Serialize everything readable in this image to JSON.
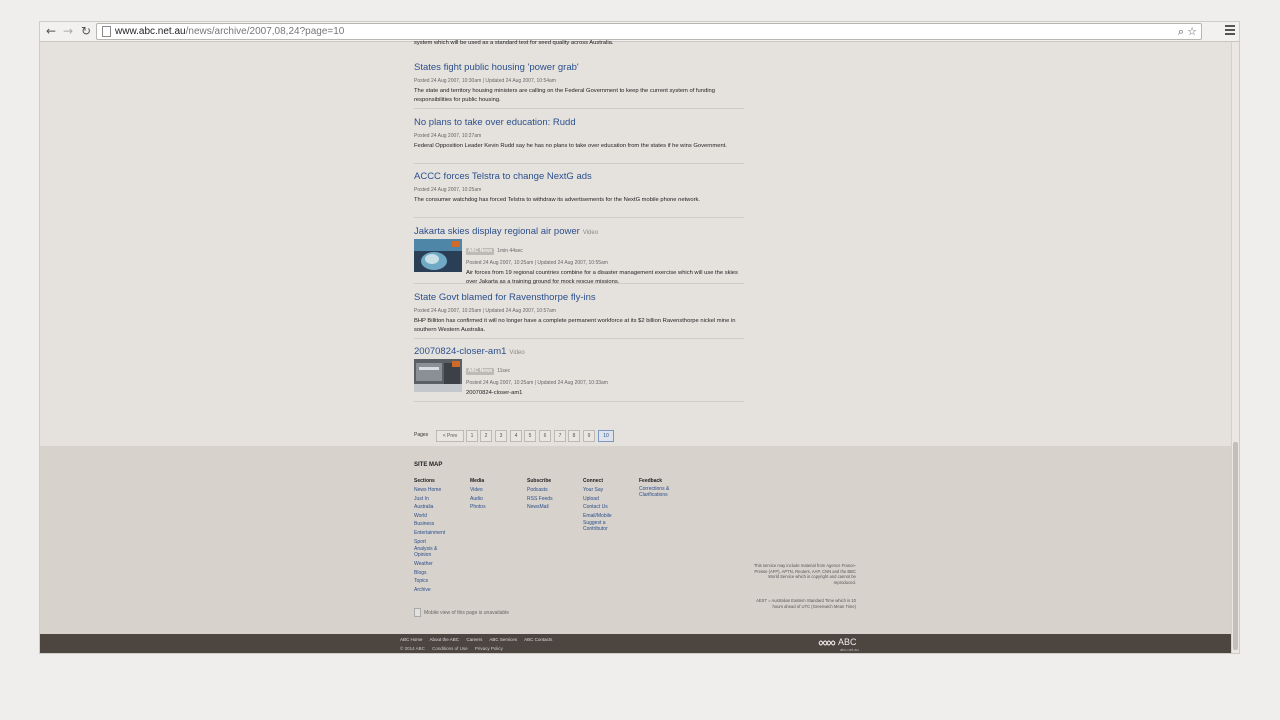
{
  "browser": {
    "back_glyph": "←",
    "forward_glyph": "→",
    "reload_glyph": "↻",
    "url_host": "www.abc.net.au",
    "url_path": "/news/archive/2007,08,24?page=10",
    "zoom_glyph": "⌕",
    "star_glyph": "☆"
  },
  "stories_truncated_text": "system which will be used as a standard test for seed quality across Australia.",
  "stories": [
    {
      "title": "States fight public housing 'power grab'",
      "meta": "Posted 24 Aug 2007, 10:30am | Updated 24 Aug 2007, 10:54am",
      "desc": "The state and territory housing ministers are calling on the Federal Government to keep the current system of funding responsibilities for public housing."
    },
    {
      "title": "No plans to take over education: Rudd",
      "meta": "Posted 24 Aug 2007, 10:27am",
      "desc": "Federal Opposition Leader Kevin Rudd say he has no plans to take over education from the states if he wins Government."
    },
    {
      "title": "ACCC forces Telstra to change NextG ads",
      "meta": "Posted 24 Aug 2007, 10:25am",
      "desc": "The consumer watchdog has forced Telstra to withdraw its advertisements for the NextG mobile phone network."
    },
    {
      "title": "Jakarta skies display regional air power",
      "type": "Video",
      "tag": "ABC News",
      "duration": "1min 44sec",
      "meta": "Posted 24 Aug 2007, 10:25am | Updated 24 Aug 2007, 10:55am",
      "desc": "Air forces from 19 regional countries combine for a disaster management exercise which will use the skies over Jakarta as a training ground for mock rescue missions."
    },
    {
      "title": "State Govt blamed for Ravensthorpe fly-ins",
      "meta": "Posted 24 Aug 2007, 10:25am | Updated 24 Aug 2007, 10:57am",
      "desc": "BHP Billiton has confirmed it will no longer have a complete permanent workforce at its $2 billion Ravensthorpe nickel mine in southern Western Australia."
    },
    {
      "title": "20070824-closer-am1",
      "type": "Video",
      "tag": "ABC News",
      "duration": "11sec",
      "meta": "Posted 24 Aug 2007, 10:25am | Updated 24 Aug 2007, 10:33am",
      "desc": "20070824-closer-am1"
    }
  ],
  "pager": {
    "label": "Pages",
    "prev": "< Prev",
    "pages": [
      "1",
      "2",
      "3",
      "4",
      "5",
      "6",
      "7",
      "8",
      "9",
      "10"
    ],
    "current": "10"
  },
  "footer": {
    "sitemap_title": "SITE MAP",
    "columns": [
      {
        "head": "Sections",
        "links": [
          "News Home",
          "Just In",
          "Australia",
          "World",
          "Business",
          "Entertainment",
          "Sport",
          "Analysis & Opinion",
          "Weather",
          "Blogs",
          "Topics",
          "Archive"
        ]
      },
      {
        "head": "Media",
        "links": [
          "Video",
          "Audio",
          "Photos"
        ]
      },
      {
        "head": "Subscribe",
        "links": [
          "Podcasts",
          "RSS Feeds",
          "NewsMail"
        ]
      },
      {
        "head": "Connect",
        "links": [
          "Your Say",
          "Upload",
          "Contact Us",
          "Email/Mobile",
          "Suggest a Contributor"
        ]
      },
      {
        "head": "Feedback",
        "links": [
          "Corrections & Clarifications"
        ]
      }
    ],
    "disclaimer": "This service may include material from Agence France-Presse (AFP), APTN, Reuters, AAP, CNN and the BBC World Service which is copyright and cannot be reproduced.",
    "aest_note": "AEST = Australian Eastern Standard Time which is 10 hours ahead of UTC (Greenwich Mean Time)",
    "mobile_note": "Mobile view of this page is unavailable"
  },
  "bottombar": {
    "links": [
      "ABC Home",
      "About the ABC",
      "Careers",
      "ABC Services",
      "ABC Contacts"
    ],
    "copyright": "© 2014 ABC",
    "legal": [
      "Conditions of Use",
      "Privacy Policy"
    ],
    "logo": "ABC",
    "logo_url": "abc.net.au"
  },
  "colors": {
    "link_blue": "#2b4f8c",
    "footer_bg": "#d7d2cc",
    "bottombar_bg": "#4d4540"
  }
}
